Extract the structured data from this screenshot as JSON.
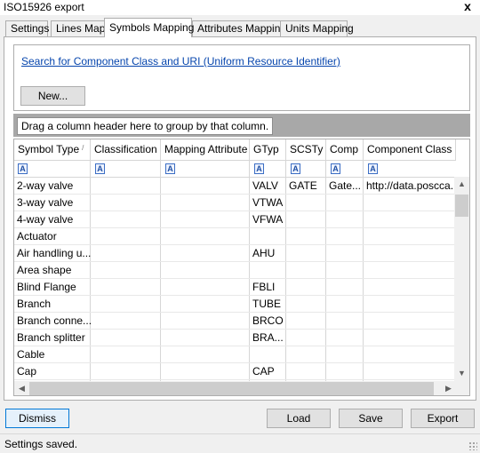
{
  "window": {
    "title": "ISO15926 export",
    "close_glyph": "x"
  },
  "tabs": [
    {
      "label": "Settings"
    },
    {
      "label": "Lines Map"
    },
    {
      "label": "Symbols Mapping"
    },
    {
      "label": "Attributes Mapping"
    },
    {
      "label": "Units Mapping"
    }
  ],
  "active_tab": "Symbols Mapping",
  "search": {
    "link_text": "Search for Component Class and URI (Uniform Resource Identifier)",
    "new_button": "New..."
  },
  "grid": {
    "group_hint": "Drag a column header here to group by that column.",
    "columns": [
      "Symbol Type",
      "Classification",
      "Mapping Attribute",
      "GTyp",
      "SCSTy",
      "Comp",
      "Component Class"
    ],
    "sorted_column": "Symbol Type",
    "sort_direction": "ascending",
    "filter_icon_glyph": "A",
    "rows": [
      [
        "2-way valve",
        "",
        "",
        "VALV",
        "GATE",
        "Gate...",
        "http://data.posccа..."
      ],
      [
        "3-way valve",
        "",
        "",
        "VTWA",
        "",
        "",
        ""
      ],
      [
        "4-way valve",
        "",
        "",
        "VFWA",
        "",
        "",
        ""
      ],
      [
        "Actuator",
        "",
        "",
        "",
        "",
        "",
        ""
      ],
      [
        "Air handling u...",
        "",
        "",
        "AHU",
        "",
        "",
        ""
      ],
      [
        "Area shape",
        "",
        "",
        "",
        "",
        "",
        ""
      ],
      [
        "Blind Flange",
        "",
        "",
        "FBLI",
        "",
        "",
        ""
      ],
      [
        "Branch",
        "",
        "",
        "TUBE",
        "",
        "",
        ""
      ],
      [
        "Branch conne...",
        "",
        "",
        "BRCO",
        "",
        "",
        ""
      ],
      [
        "Branch splitter",
        "",
        "",
        "BRA...",
        "",
        "",
        ""
      ],
      [
        "Cable",
        "",
        "",
        "",
        "",
        "",
        ""
      ],
      [
        "Cap",
        "",
        "",
        "CAP",
        "",
        "",
        ""
      ]
    ]
  },
  "buttons": {
    "dismiss": "Dismiss",
    "load": "Load",
    "save": "Save",
    "export": "Export"
  },
  "status": {
    "text": "Settings saved."
  },
  "colors": {
    "link": "#0645ad",
    "group_panel": "#a8a8a8",
    "focus_border": "#0078d7"
  }
}
